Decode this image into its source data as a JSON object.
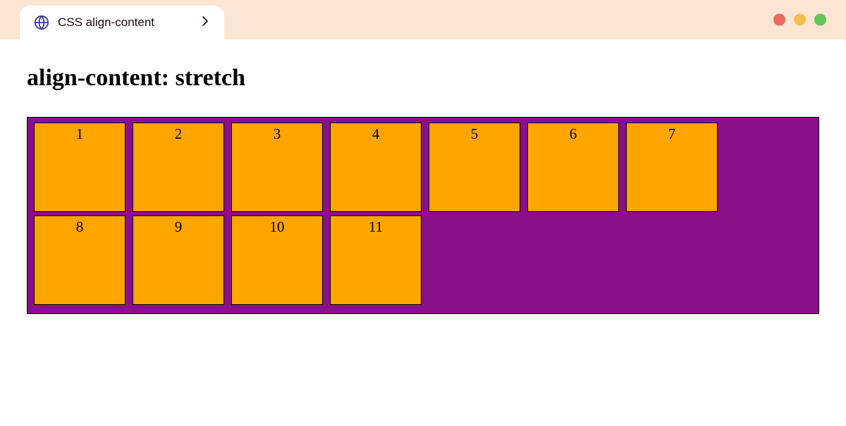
{
  "browser": {
    "tab_title": "CSS align-content"
  },
  "page": {
    "heading": "align-content: stretch"
  },
  "flex": {
    "items": [
      {
        "label": "1"
      },
      {
        "label": "2"
      },
      {
        "label": "3"
      },
      {
        "label": "4"
      },
      {
        "label": "5"
      },
      {
        "label": "6"
      },
      {
        "label": "7"
      },
      {
        "label": "8"
      },
      {
        "label": "9"
      },
      {
        "label": "10"
      },
      {
        "label": "11"
      }
    ]
  }
}
